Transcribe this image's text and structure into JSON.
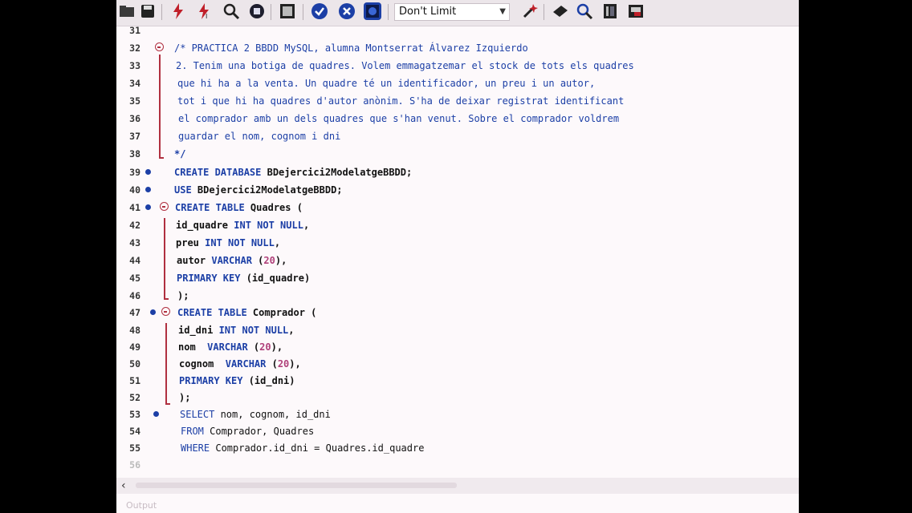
{
  "toolbar": {
    "limit_value": "Don't Limit",
    "icons": [
      "open-folder-icon",
      "save-icon",
      "execute-icon",
      "execute-current-icon",
      "explain-icon",
      "stop-icon",
      "toggle-output-icon",
      "commit-icon",
      "rollback-icon",
      "autocommit-icon",
      "limit-select",
      "beautify-icon",
      "find-icon",
      "invisible-chars-icon",
      "wrap-icon"
    ]
  },
  "editor": {
    "lines": [
      {
        "n": "31",
        "text": ""
      },
      {
        "n": "32",
        "text": "/* PRACTICA 2 BBDD MySQL, alumna Montserrat Álvarez Izquierdo"
      },
      {
        "n": "33",
        "text": "2. Tenim una botiga de quadres. Volem emmagatzemar el stock de tots els quadres"
      },
      {
        "n": "34",
        "text": "que hi ha a la venta. Un quadre té un identificador, un preu i un autor,"
      },
      {
        "n": "35",
        "text": "tot i que hi ha quadres d'autor anònim. S'ha de deixar registrat identificant"
      },
      {
        "n": "36",
        "text": "el comprador amb un dels quadres que s'han venut. Sobre el comprador voldrem"
      },
      {
        "n": "37",
        "text": "guardar el nom, cognom i dni"
      },
      {
        "n": "38",
        "text": "*/"
      },
      {
        "n": "39",
        "text": "CREATE DATABASE BDejercici2ModelatgeBBDD;"
      },
      {
        "n": "40",
        "text": "USE BDejercici2ModelatgeBBDD;"
      },
      {
        "n": "41",
        "text": "CREATE TABLE Quadres ("
      },
      {
        "n": "42",
        "text": "id_quadre INT NOT NULL,"
      },
      {
        "n": "43",
        "text": "preu INT NOT NULL,"
      },
      {
        "n": "44",
        "text": "autor VARCHAR (20),"
      },
      {
        "n": "45",
        "text": "PRIMARY KEY (id_quadre)"
      },
      {
        "n": "46",
        "text": ");"
      },
      {
        "n": "47",
        "text": "CREATE TABLE Comprador ("
      },
      {
        "n": "48",
        "text": "id_dni INT NOT NULL,"
      },
      {
        "n": "49",
        "text": "nom  VARCHAR (20),"
      },
      {
        "n": "50",
        "text": "cognom  VARCHAR (20),"
      },
      {
        "n": "51",
        "text": "PRIMARY KEY (id_dni)"
      },
      {
        "n": "52",
        "text": ");"
      },
      {
        "n": "53",
        "text": "SELECT nom, cognom, id_dni"
      },
      {
        "n": "54",
        "text": "FROM Comprador, Quadres"
      },
      {
        "n": "55",
        "text": "WHERE Comprador.id_dni = Quadres.id_quadre"
      },
      {
        "n": "56",
        "text": ""
      }
    ]
  },
  "output_panel": {
    "label": "Output"
  },
  "colors": {
    "keyword": "#1c3fa6",
    "comment": "#1c3fa6",
    "number": "#b0407a",
    "fold": "#b03040",
    "background": "#fdf9fb"
  }
}
